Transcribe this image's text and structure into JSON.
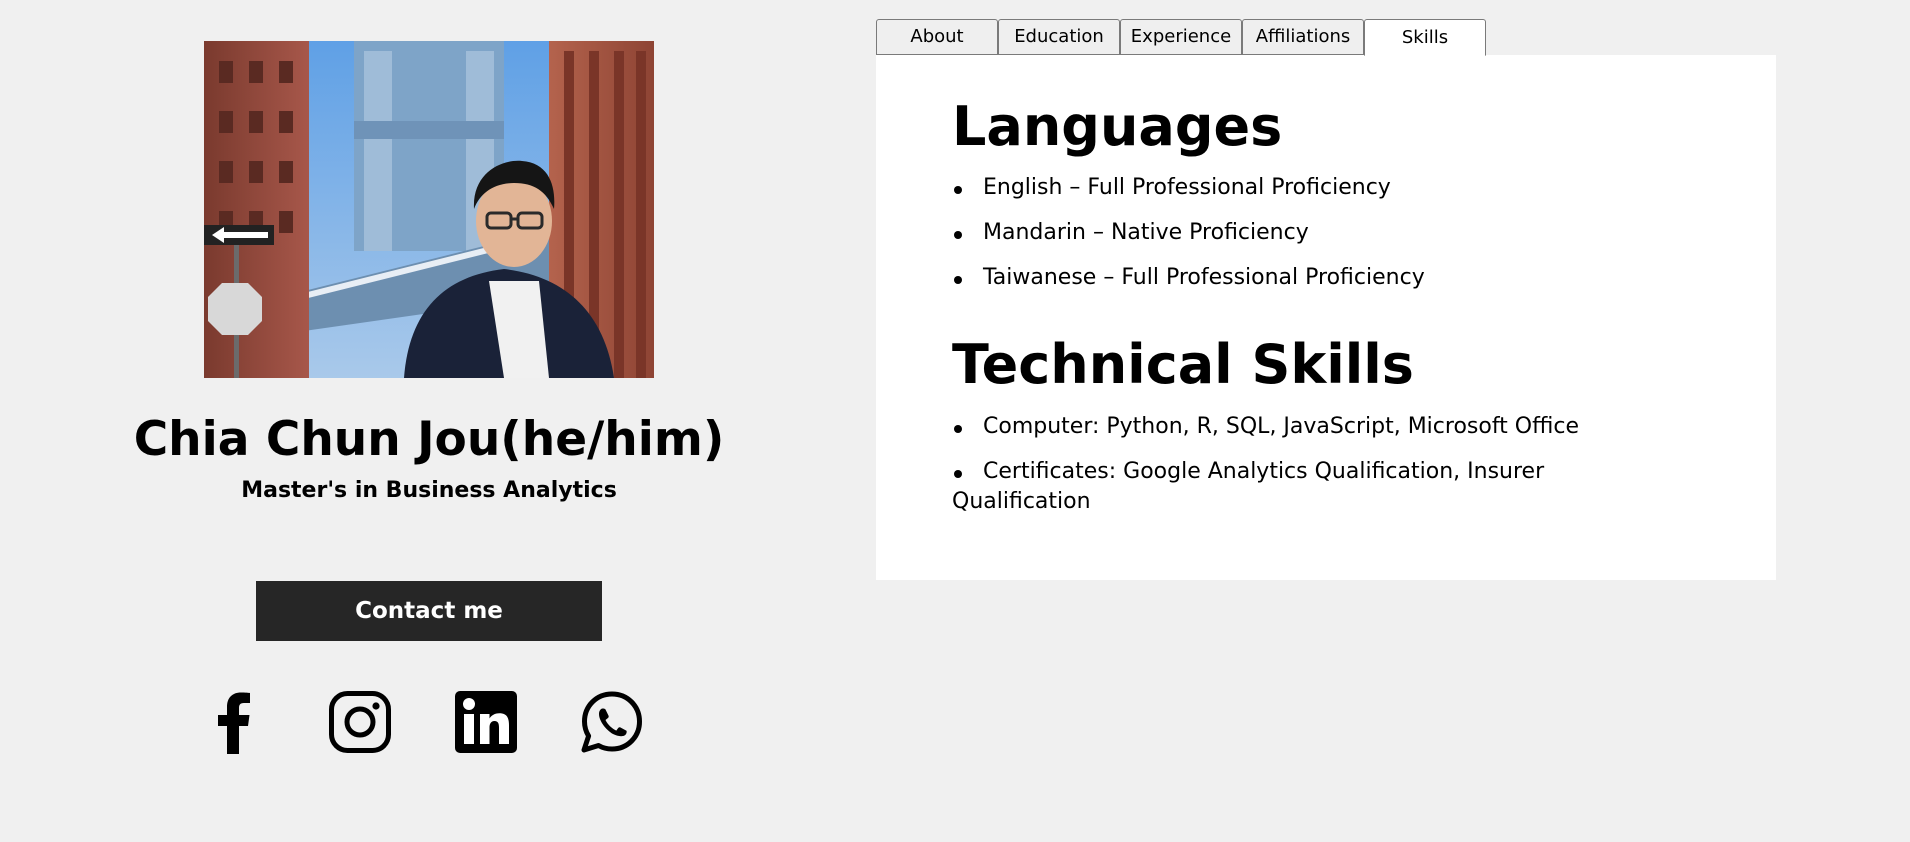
{
  "profile": {
    "name": "Chia Chun Jou(he/him)",
    "subtitle": "Master's in Business Analytics",
    "contact_label": "Contact me",
    "photo_icon": "profile-photo"
  },
  "social": [
    {
      "icon": "facebook-icon"
    },
    {
      "icon": "instagram-icon"
    },
    {
      "icon": "linkedin-icon"
    },
    {
      "icon": "whatsapp-icon"
    }
  ],
  "tabs": [
    {
      "label": "About",
      "active": false
    },
    {
      "label": "Education",
      "active": false
    },
    {
      "label": "Experience",
      "active": false
    },
    {
      "label": "Affiliations",
      "active": false
    },
    {
      "label": "Skills",
      "active": true
    }
  ],
  "skills": {
    "languages_heading": "Languages",
    "languages": [
      "English – Full Professional Proficiency",
      "Mandarin – Native Proficiency",
      "Taiwanese – Full Professional Proficiency"
    ],
    "technical_heading": "Technical Skills",
    "technical": [
      "Computer: Python, R, SQL, JavaScript, Microsoft Office",
      "Certificates: Google Analytics Qualification, Insurer Qualification"
    ]
  },
  "colors": {
    "page_background": "#f0f0f0",
    "button_background": "#262626",
    "button_text": "#ffffff",
    "panel_background": "#ffffff"
  }
}
